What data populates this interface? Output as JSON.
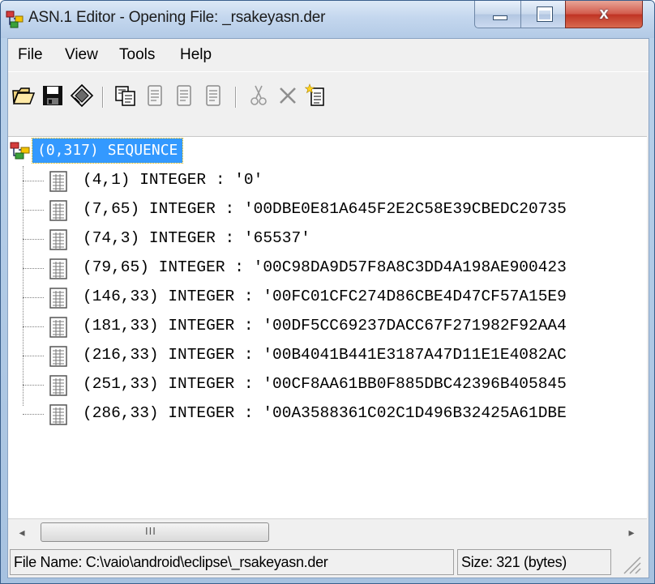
{
  "window": {
    "title": "ASN.1 Editor - Opening File: _rsakeyasn.der",
    "buttons": {
      "minimize": "minimize",
      "maximize": "maximize",
      "close": "x"
    }
  },
  "menu": [
    "File",
    "View",
    "Tools",
    "Help"
  ],
  "toolbar": [
    {
      "icon": "open-folder-icon",
      "enabled": true
    },
    {
      "icon": "save-disk-icon",
      "enabled": true
    },
    {
      "icon": "certificate-icon",
      "enabled": true
    },
    {
      "icon": "copy-icon",
      "enabled": true
    },
    {
      "icon": "document-icon",
      "enabled": false
    },
    {
      "icon": "document-icon",
      "enabled": false
    },
    {
      "icon": "document-icon",
      "enabled": false
    },
    {
      "icon": "cut-icon",
      "enabled": false
    },
    {
      "icon": "delete-icon",
      "enabled": false
    },
    {
      "icon": "new-node-icon",
      "enabled": true
    }
  ],
  "tree": {
    "root": "(0,317) SEQUENCE",
    "children": [
      "(4,1) INTEGER : '0'",
      "(7,65) INTEGER : '00DBE0E81A645F2E2C58E39CBEDC20735",
      "(74,3) INTEGER : '65537'",
      "(79,65) INTEGER : '00C98DA9D57F8A8C3DD4A198AE900423",
      "(146,33) INTEGER : '00FC01CFC274D86CBE4D47CF57A15E9",
      "(181,33) INTEGER : '00DF5CC69237DACC67F271982F92AA4",
      "(216,33) INTEGER : '00B4041B441E3187A47D11E1E4082AC",
      "(251,33) INTEGER : '00CF8AA61BB0F885DBC42396B405845",
      "(286,33) INTEGER : '00A3588361C02C1D496B32425A61DBE"
    ]
  },
  "scrollbar": {
    "left_arrow": "◂",
    "right_arrow": "▸",
    "grip": "III"
  },
  "status": {
    "file_name": "File Name: C:\\vaio\\android\\eclipse\\_rsakeyasn.der",
    "size": "Size: 321 (bytes)"
  }
}
